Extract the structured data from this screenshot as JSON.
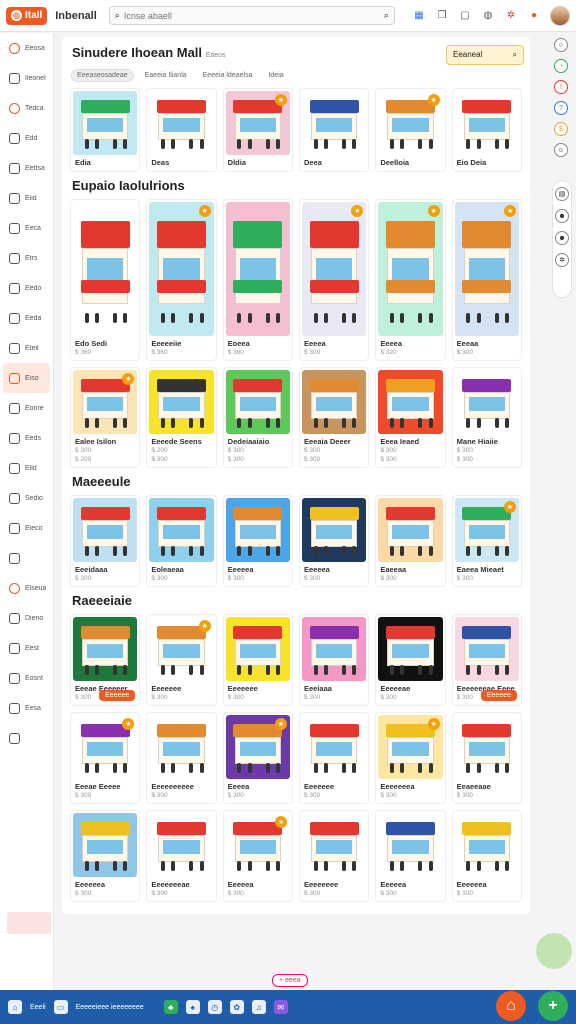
{
  "topbar": {
    "logo_text": "Itall",
    "brand": "Inbenall",
    "search_placeholder": "Icnse abaell",
    "icons": [
      "grid-icon",
      "bookmark-icon",
      "calendar-icon",
      "globe-icon",
      "settings-icon",
      "notification-icon",
      "avatar"
    ]
  },
  "sidebar": {
    "items": [
      {
        "label": "Eeosa",
        "icon": "home-icon",
        "hot": true
      },
      {
        "label": "Ileonel",
        "icon": "card-icon"
      },
      {
        "label": "Tedca",
        "icon": "fire-icon",
        "hot": true
      },
      {
        "label": "Edd",
        "icon": "doc-icon"
      },
      {
        "label": "Eettsa",
        "icon": "doc-icon"
      },
      {
        "label": "Eiid",
        "icon": "doc-icon"
      },
      {
        "label": "Eeca",
        "icon": "bag-icon"
      },
      {
        "label": "Etrs",
        "icon": "edit-icon"
      },
      {
        "label": "Eedo",
        "icon": "doc-icon"
      },
      {
        "label": "Eeda",
        "icon": "card-icon"
      },
      {
        "label": "Eteil",
        "icon": "doc-icon"
      },
      {
        "label": "Eiso",
        "icon": "gift-icon",
        "active": true
      },
      {
        "label": "Eoore",
        "icon": "box-icon"
      },
      {
        "label": "Eeds",
        "icon": "card-icon"
      },
      {
        "label": "Elld",
        "icon": "doc-icon"
      },
      {
        "label": "Sedio",
        "icon": "doc-icon"
      },
      {
        "label": "Eieco",
        "icon": "circle-icon"
      },
      {
        "label": "",
        "icon": "clock-icon"
      },
      {
        "label": "Elseua",
        "icon": "dot-icon",
        "hot": true
      },
      {
        "label": "Dieno",
        "icon": "dot-icon"
      },
      {
        "label": "Eest",
        "icon": "doc-icon"
      },
      {
        "label": "Eosnt",
        "icon": "doc-icon"
      },
      {
        "label": "Eesa",
        "icon": "bag-icon"
      },
      {
        "label": "",
        "icon": "profile-icon"
      }
    ]
  },
  "header": {
    "title": "Sinudere Ihoean Mall",
    "subtitle": "Eaeos",
    "button_label": "Eeaneal",
    "filters": [
      "Eeeaseosadeae",
      "Eaeeia Ilianla",
      "Eeeeia ldeaelsa",
      "Ideia"
    ]
  },
  "sections": [
    {
      "title": "",
      "tall": false,
      "items": [
        {
          "name": "Edia",
          "price": "",
          "roof": "#2fae5b",
          "bg": "#bfe8f3",
          "badge": false
        },
        {
          "name": "Deas",
          "price": "",
          "roof": "#e2382f",
          "bg": "#fff",
          "badge": false
        },
        {
          "name": "Dldia",
          "price": "",
          "roof": "#e2382f",
          "bg": "#f3c7d6",
          "badge": true
        },
        {
          "name": "Deea",
          "price": "",
          "roof": "#2e55a5",
          "bg": "#fff",
          "badge": false
        },
        {
          "name": "Deelloia",
          "price": "",
          "roof": "#e28a2f",
          "bg": "#fff",
          "badge": true
        },
        {
          "name": "Eio Deia",
          "price": "",
          "roof": "#e2382f",
          "bg": "#fff",
          "badge": false
        }
      ]
    },
    {
      "title": "Eupaio Iaolulrions",
      "tall": true,
      "items": [
        {
          "name": "Edo Sedi",
          "price": "$ 360",
          "roof": "#e2382f",
          "bg": "#fff",
          "badge": false
        },
        {
          "name": "Eeeeeiie",
          "price": "$ 360",
          "roof": "#e2382f",
          "bg": "#bfe8ef",
          "badge": true
        },
        {
          "name": "Eoeea",
          "price": "$ 360",
          "roof": "#2fae5b",
          "bg": "#f3bfd1",
          "badge": false
        },
        {
          "name": "Eeeea",
          "price": "$ 300",
          "roof": "#e2382f",
          "bg": "#e9e9f5",
          "badge": true
        },
        {
          "name": "Eeeea",
          "price": "$ 320",
          "roof": "#e28a2f",
          "bg": "#bff0dc",
          "badge": true
        },
        {
          "name": "Eeeaa",
          "price": "$ 300",
          "roof": "#e28a2f",
          "bg": "#d5e4f2",
          "badge": true
        }
      ]
    },
    {
      "title": "",
      "tall": false,
      "items": [
        {
          "name": "Ealee Isilon",
          "price": "$ 300",
          "price2": "$ 200",
          "roof": "#e2382f",
          "bg": "#fbe5b4",
          "badge": true
        },
        {
          "name": "Eeeede Seens",
          "price": "$ 200",
          "price2": "$ 300",
          "roof": "#333",
          "bg": "#f9e22a",
          "badge": false
        },
        {
          "name": "Dedeiaaiaio",
          "price": "$ 300",
          "price2": "$ 300",
          "roof": "#e2382f",
          "bg": "#5cc95a",
          "badge": false
        },
        {
          "name": "Eeeaia Deeer",
          "price": "$ 300",
          "price2": "$ 300",
          "roof": "#e28a2f",
          "bg": "#c8955e",
          "badge": false
        },
        {
          "name": "Eeea Ieaed",
          "price": "$ 300",
          "price2": "$ 300",
          "roof": "#f0a020",
          "bg": "#ef4a2a",
          "badge": false
        },
        {
          "name": "Mane Hiaiie",
          "price": "$ 300",
          "price2": "$ 300",
          "roof": "#8a2fae",
          "bg": "#fff",
          "badge": false
        }
      ]
    },
    {
      "title": "Maeeeule",
      "tall": false,
      "items": [
        {
          "name": "Eeeidaaa",
          "price": "$ 300",
          "roof": "#e2382f",
          "bg": "#bfe0f3",
          "badge": false
        },
        {
          "name": "Eoleaeaa",
          "price": "$ 300",
          "roof": "#e2382f",
          "bg": "#8fd0ee",
          "badge": false
        },
        {
          "name": "Eeeeea",
          "price": "$ 300",
          "roof": "#e28a2f",
          "bg": "#4aa6e8",
          "badge": false
        },
        {
          "name": "Eeeeea",
          "price": "$ 300",
          "roof": "#f0c020",
          "bg": "#1f3a5e",
          "badge": false
        },
        {
          "name": "Eaeeaa",
          "price": "$ 300",
          "roof": "#e2382f",
          "bg": "#fbd9a5",
          "badge": false
        },
        {
          "name": "Eaeea Mieaet",
          "price": "$ 300",
          "roof": "#2fae5b",
          "bg": "#cde8f5",
          "badge": true
        }
      ]
    },
    {
      "title": "Raeeeiaie",
      "tall": false,
      "items": [
        {
          "name": "Eeeae Eeeeeer",
          "price": "$ 300",
          "roof": "#e28a2f",
          "bg": "#1e7a3a",
          "badge": false,
          "cta": "Eeeeee"
        },
        {
          "name": "Eeeeeee",
          "price": "$ 300",
          "roof": "#e28a2f",
          "bg": "#fff",
          "badge": true
        },
        {
          "name": "Eeeeeee",
          "price": "$ 300",
          "roof": "#e2382f",
          "bg": "#f9e22a",
          "badge": false
        },
        {
          "name": "Eeeiaaa",
          "price": "$ 300",
          "roof": "#8a2fae",
          "bg": "#f598c8",
          "badge": false
        },
        {
          "name": "Eeeeeae",
          "price": "$ 300",
          "roof": "#e2382f",
          "bg": "#111",
          "badge": false
        },
        {
          "name": "Eeeeeeeae Eeee",
          "price": "$ 300",
          "roof": "#2e55a5",
          "bg": "#f9d7e4",
          "badge": false,
          "cta": "Eeeeee"
        }
      ]
    },
    {
      "title": "",
      "tall": false,
      "items": [
        {
          "name": "Eeeae Eeeee",
          "price": "$ 300",
          "roof": "#8a2fae",
          "bg": "#fff",
          "badge": true
        },
        {
          "name": "Eeeeeeeeee",
          "price": "$ 300",
          "roof": "#e28a2f",
          "bg": "#fff",
          "badge": false
        },
        {
          "name": "Eeeea",
          "price": "$ 300",
          "roof": "#e28a2f",
          "bg": "#6b3aa6",
          "badge": true
        },
        {
          "name": "Eeeeeee",
          "price": "$ 300",
          "roof": "#e2382f",
          "bg": "#fff",
          "badge": false
        },
        {
          "name": "Eeeeeeea",
          "price": "$ 300",
          "roof": "#f0c020",
          "bg": "#fde6a0",
          "badge": true
        },
        {
          "name": "Eeaeeaae",
          "price": "$ 300",
          "roof": "#e2382f",
          "bg": "#fff",
          "badge": false
        }
      ]
    },
    {
      "title": "",
      "tall": false,
      "items": [
        {
          "name": "Eeeeeea",
          "price": "$ 300",
          "roof": "#f0c020",
          "bg": "#8fc6e8",
          "badge": false
        },
        {
          "name": "Eeeeeeeae",
          "price": "$ 300",
          "roof": "#e2382f",
          "bg": "#fff",
          "badge": false
        },
        {
          "name": "Eeeeea",
          "price": "$ 300",
          "roof": "#e2382f",
          "bg": "#fff",
          "badge": true
        },
        {
          "name": "Eeeeeeee",
          "price": "$ 300",
          "roof": "#e2382f",
          "bg": "#fff",
          "badge": false
        },
        {
          "name": "Eeeeea",
          "price": "$ 300",
          "roof": "#2e55a5",
          "bg": "#fff",
          "badge": false
        },
        {
          "name": "Eeeeeea",
          "price": "$ 300",
          "roof": "#f0c020",
          "bg": "#fff",
          "badge": false
        }
      ]
    }
  ],
  "bottombar": {
    "left_label": "Eeeli",
    "center_label": "Eeeeeieee ieeeeeeee",
    "pill_label": "+ eeea",
    "fab_orange": "⌂",
    "fab_green": "+"
  },
  "colors": {
    "accent": "#ef5a22",
    "bottom": "#1f5da8",
    "highlight": "#fff3d1"
  }
}
